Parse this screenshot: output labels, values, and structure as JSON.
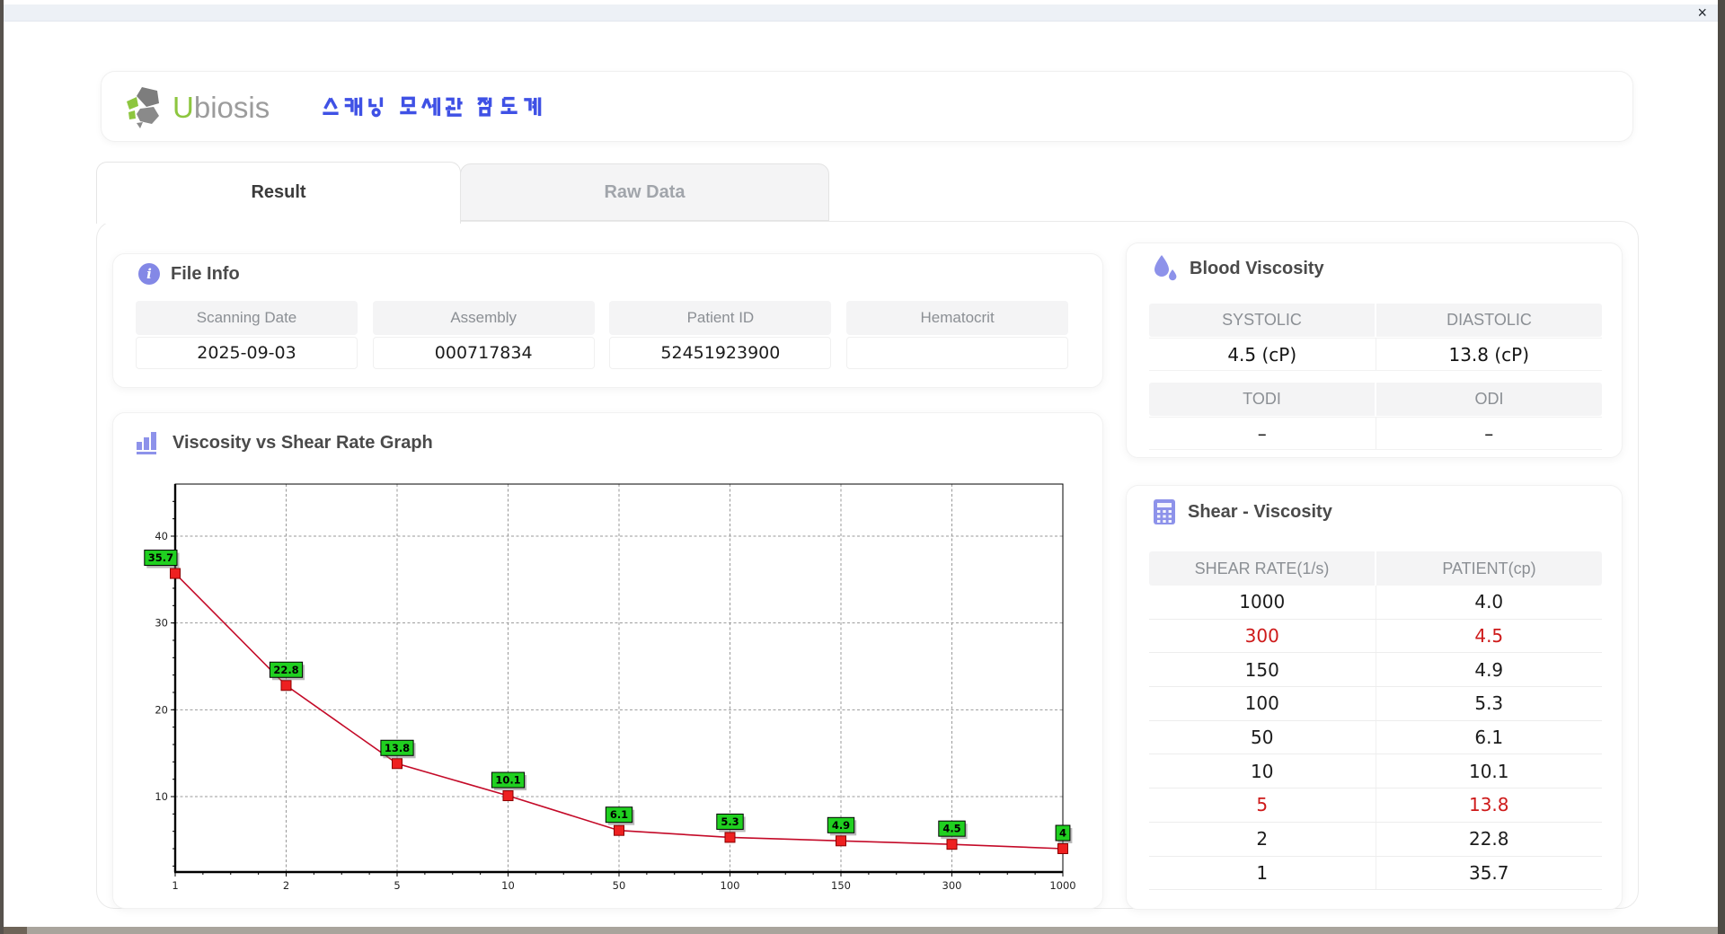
{
  "window": {
    "close_label": "×"
  },
  "header": {
    "brand_accent_letter": "U",
    "brand_rest": "biosis",
    "brand_accent_color": "#8dc63f",
    "title_ko": "스캐닝 모세관 점도계",
    "title_color": "#3f51e5"
  },
  "tabs": [
    {
      "label": "Result",
      "active": true
    },
    {
      "label": "Raw Data",
      "active": false
    }
  ],
  "file_info": {
    "title": "File Info",
    "fields": [
      {
        "label": "Scanning Date",
        "value": "2025-09-03"
      },
      {
        "label": "Assembly",
        "value": "000717834"
      },
      {
        "label": "Patient ID",
        "value": "52451923900"
      },
      {
        "label": "Hematocrit",
        "value": ""
      }
    ]
  },
  "blood_viscosity": {
    "title": "Blood Viscosity",
    "cells": [
      {
        "label": "SYSTOLIC",
        "value": "4.5 (cP)"
      },
      {
        "label": "DIASTOLIC",
        "value": "13.8 (cP)"
      },
      {
        "label": "TODI",
        "value": "–"
      },
      {
        "label": "ODI",
        "value": "–"
      }
    ]
  },
  "graph": {
    "title": "Viscosity vs Shear Rate Graph"
  },
  "chart_data": {
    "type": "line",
    "title": "Viscosity vs Shear Rate Graph",
    "categories": [
      1,
      2,
      5,
      10,
      50,
      100,
      150,
      300,
      1000
    ],
    "values": [
      35.7,
      22.8,
      13.8,
      10.1,
      6.1,
      5.3,
      4.9,
      4.5,
      4.0
    ],
    "point_labels": [
      "35.7",
      "22.8",
      "13.8",
      "10.1",
      "6.1",
      "5.3",
      "4.9",
      "4.5",
      "4"
    ],
    "xlabel": "",
    "ylabel": "",
    "y_ticks": [
      10,
      20,
      30,
      40
    ],
    "ylim": [
      1.3,
      46
    ],
    "x_axis_type": "categorical-log-ticks",
    "grid": true,
    "line_color": "#c40a28",
    "marker_color": "#ee2020",
    "label_bg": "#20d020"
  },
  "shear_table": {
    "title": "Shear - Viscosity",
    "columns": [
      "SHEAR RATE(1/s)",
      "PATIENT(cp)"
    ],
    "rows": [
      [
        "1000",
        "4.0"
      ],
      [
        "300",
        "4.5"
      ],
      [
        "150",
        "4.9"
      ],
      [
        "100",
        "5.3"
      ],
      [
        "50",
        "6.1"
      ],
      [
        "10",
        "10.1"
      ],
      [
        "5",
        "13.8"
      ],
      [
        "2",
        "22.8"
      ],
      [
        "1",
        "35.7"
      ]
    ],
    "red_rows": [
      1,
      6
    ],
    "red_color": "#ce1a1a"
  }
}
